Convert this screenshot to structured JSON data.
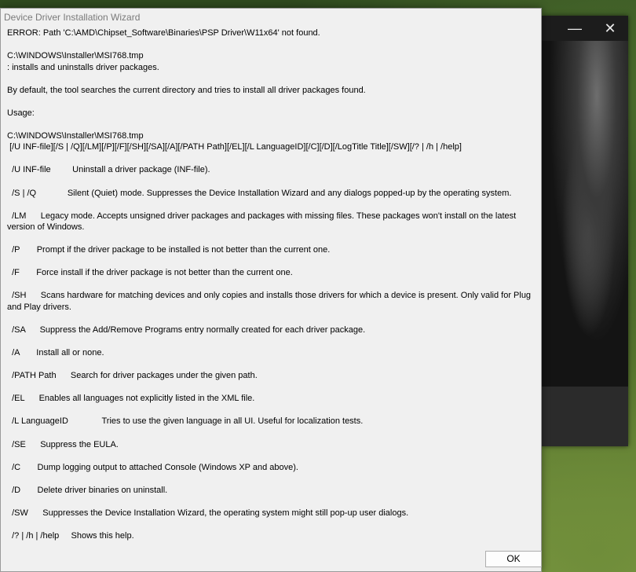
{
  "dialog": {
    "title": "Device Driver Installation Wizard",
    "ok_label": "OK",
    "lines": {
      "error": "ERROR: Path 'C:\\AMD\\Chipset_Software\\Binaries\\PSP Driver\\W11x64' not found.",
      "path1": "C:\\WINDOWS\\Installer\\MSI768.tmp",
      "desc": ": installs and uninstalls driver packages.",
      "default": "By default, the tool searches the current directory and tries to install all driver packages found.",
      "usage": "Usage:",
      "path2": "C:\\WINDOWS\\Installer\\MSI768.tmp",
      "syntax": " [/U INF-file][/S | /Q][/LM][/P][/F][/SH][/SA][/A][/PATH Path][/EL][/L LanguageID][/C][/D][/LogTitle Title][/SW][/? | /h | /help]",
      "u": "  /U INF-file         Uninstall a driver package (INF-file).",
      "s": "  /S | /Q             Silent (Quiet) mode. Suppresses the Device Installation Wizard and any dialogs popped-up by the operating system.",
      "lm": "  /LM      Legacy mode. Accepts unsigned driver packages and packages with missing files. These packages won't install on the latest version of Windows.",
      "p": "  /P       Prompt if the driver package to be installed is not better than the current one.",
      "f": "  /F       Force install if the driver package is not better than the current one.",
      "sh": "  /SH      Scans hardware for matching devices and only copies and installs those drivers for which a device is present. Only valid for Plug and Play drivers.",
      "sa": "  /SA      Suppress the Add/Remove Programs entry normally created for each driver package.",
      "a": "  /A       Install all or none.",
      "path": "  /PATH Path      Search for driver packages under the given path.",
      "el": "  /EL      Enables all languages not explicitly listed in the XML file.",
      "l": "  /L LanguageID              Tries to use the given language in all UI. Useful for localization tests.",
      "se": "  /SE      Suppress the EULA.",
      "c": "  /C       Dump logging output to attached Console (Windows XP and above).",
      "d": "  /D       Delete driver binaries on uninstall.",
      "sw": "  /SW      Suppresses the Device Installation Wizard, the operating system might still pop-up user dialogs.",
      "help": "  /? | /h | /help     Shows this help."
    }
  },
  "background_window": {
    "minimize_icon": "minimize-icon",
    "close_icon": "close-icon"
  }
}
